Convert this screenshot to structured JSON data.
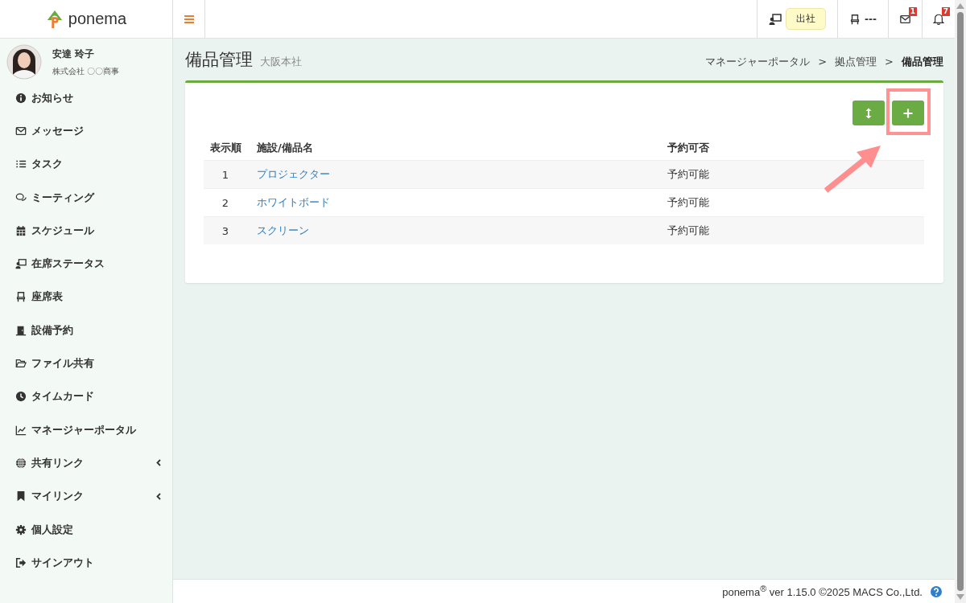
{
  "brand": {
    "name": "ponema"
  },
  "header": {
    "attendance": "出社",
    "seat": "---",
    "mail_badge": "1",
    "bell_badge": "7"
  },
  "user": {
    "name": "安達 玲子",
    "company": "株式会社 〇〇商事"
  },
  "sidebar": {
    "items": [
      {
        "label": "お知らせ",
        "submenu": false
      },
      {
        "label": "メッセージ",
        "submenu": false
      },
      {
        "label": "タスク",
        "submenu": false
      },
      {
        "label": "ミーティング",
        "submenu": false
      },
      {
        "label": "スケジュール",
        "submenu": false
      },
      {
        "label": "在席ステータス",
        "submenu": false
      },
      {
        "label": "座席表",
        "submenu": false
      },
      {
        "label": "設備予約",
        "submenu": false
      },
      {
        "label": "ファイル共有",
        "submenu": false
      },
      {
        "label": "タイムカード",
        "submenu": false
      },
      {
        "label": "マネージャーポータル",
        "submenu": false
      },
      {
        "label": "共有リンク",
        "submenu": true
      },
      {
        "label": "マイリンク",
        "submenu": true
      },
      {
        "label": "個人設定",
        "submenu": false
      },
      {
        "label": "サインアウト",
        "submenu": false
      }
    ]
  },
  "page": {
    "title": "備品管理",
    "subtitle": "大阪本社",
    "breadcrumbs": [
      {
        "label": "マネージャーポータル",
        "current": false
      },
      {
        "label": "拠点管理",
        "current": false
      },
      {
        "label": "備品管理",
        "current": true
      }
    ],
    "separator": ">"
  },
  "table": {
    "columns": [
      "表示順",
      "施設/備品名",
      "予約可否"
    ],
    "rows": [
      {
        "order": "1",
        "name": "プロジェクター",
        "availability": "予約可能"
      },
      {
        "order": "2",
        "name": "ホワイトボード",
        "availability": "予約可能"
      },
      {
        "order": "3",
        "name": "スクリーン",
        "availability": "予約可能"
      }
    ]
  },
  "footer": {
    "text": "ponema$^{®}$ ver 1.15.0 ©2025 MACS Co.,Ltd."
  }
}
